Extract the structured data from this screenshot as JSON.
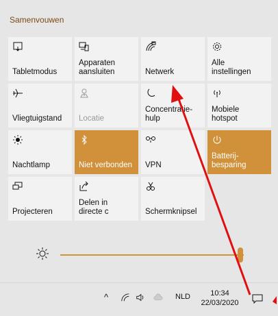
{
  "panel": {
    "collapse_label": "Samenvouwen"
  },
  "tiles": [
    {
      "id": "tablet",
      "label": "Tabletmodus",
      "icon": "tablet-mode-icon",
      "state": "off"
    },
    {
      "id": "connect",
      "label": "Apparaten\naansluiten",
      "icon": "connect-devices-icon",
      "state": "off"
    },
    {
      "id": "network",
      "label": "Netwerk",
      "icon": "network-icon",
      "state": "off"
    },
    {
      "id": "settings",
      "label": "Alle\ninstellingen",
      "icon": "gear-icon",
      "state": "off"
    },
    {
      "id": "airplane",
      "label": "Vliegtuigstand",
      "icon": "airplane-icon",
      "state": "off"
    },
    {
      "id": "location",
      "label": "Locatie",
      "icon": "location-icon",
      "state": "disabled"
    },
    {
      "id": "focus",
      "label": "Concentratie-\nhulp",
      "icon": "moon-icon",
      "state": "off"
    },
    {
      "id": "hotspot",
      "label": "Mobiele\nhotspot",
      "icon": "hotspot-icon",
      "state": "off"
    },
    {
      "id": "nightlight",
      "label": "Nachtlamp",
      "icon": "nightlight-icon",
      "state": "off"
    },
    {
      "id": "bluetooth",
      "label": "Niet verbonden",
      "icon": "bluetooth-icon",
      "state": "on"
    },
    {
      "id": "vpn",
      "label": "VPN",
      "icon": "vpn-icon",
      "state": "off"
    },
    {
      "id": "battery",
      "label": "Batterij-\nbesparing",
      "icon": "battery-saver-icon",
      "state": "on"
    },
    {
      "id": "project",
      "label": "Projecteren",
      "icon": "project-icon",
      "state": "off"
    },
    {
      "id": "share",
      "label": "Delen in\ndirecte c",
      "icon": "nearby-share-icon",
      "state": "off"
    },
    {
      "id": "snip",
      "label": "Schermknipsel",
      "icon": "snip-icon",
      "state": "off"
    }
  ],
  "brightness": {
    "icon": "brightness-sun-icon",
    "value_percent": 100
  },
  "taskbar": {
    "language": "NLD",
    "time": "10:34",
    "date": "22/03/2020"
  },
  "colors": {
    "accent": "#d0913a",
    "panel_bg": "#e6e6e6",
    "tile_bg": "#f2f2f2",
    "annotation_arrow": "#e01010"
  }
}
